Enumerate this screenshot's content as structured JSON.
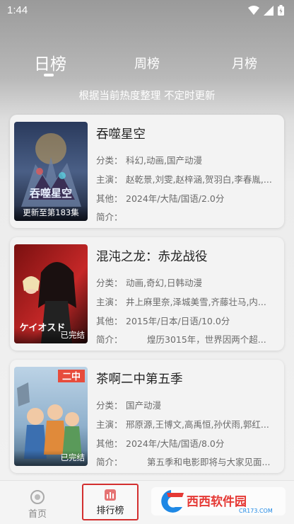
{
  "status_bar": {
    "time": "1:44"
  },
  "tabs": [
    {
      "label": "日榜",
      "active": true
    },
    {
      "label": "周榜",
      "active": false
    },
    {
      "label": "月榜",
      "active": false
    }
  ],
  "subtitle": "根据当前热度整理 不定时更新",
  "labels": {
    "genre": "分类：",
    "cast": "主演：",
    "other": "其他：",
    "intro": "简介："
  },
  "items": [
    {
      "title": "吞噬星空",
      "genre": "科幻,动画,国产动漫",
      "cast": "赵乾景,刘雯,赵梓涵,贺羽白,李春胤,...",
      "other": "2024年/大陆/国语/2.0分",
      "intro": "",
      "cover_badge": "更新至第183集",
      "cover_text": "吞噬星空"
    },
    {
      "title": "混沌之龙：赤龙战役",
      "genre": "动画,奇幻,日韩动漫",
      "cast": "井上麻里奈,泽城美雪,齐藤壮马,内...",
      "other": "2015年/日本/日语/10.0分",
      "intro": "煌历3015年，世界因两个超...",
      "cover_badge": "已完结",
      "cover_text": "ケイオスド"
    },
    {
      "title": "茶啊二中第五季",
      "genre": "国产动漫",
      "cast": "邢原源,王博文,高禹恒,孙伏雨,郭红...",
      "other": "2024年/大陆/国语/8.0分",
      "intro": "第五季和电影即将与大家见面...",
      "cover_badge": "已完结",
      "cover_text": "二中"
    }
  ],
  "bottom_nav": [
    {
      "label": "首页",
      "icon": "home-icon"
    },
    {
      "label": "排行榜",
      "icon": "rank-icon"
    }
  ],
  "watermark": {
    "brand": "西西软件园",
    "url": "CR173.COM"
  }
}
